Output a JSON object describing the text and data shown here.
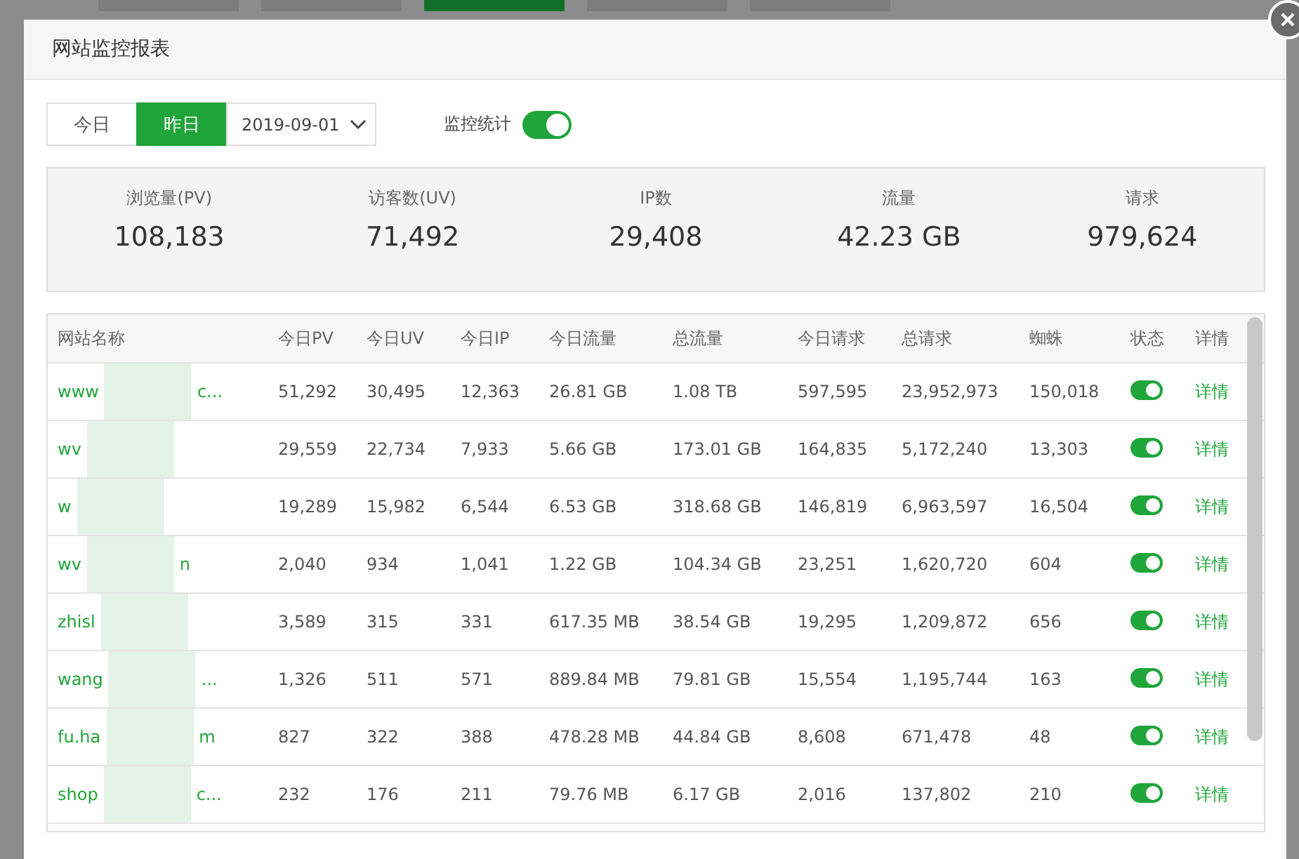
{
  "dialog": {
    "title": "网站监控报表"
  },
  "range_tabs": [
    {
      "label": "今日",
      "selected": false
    },
    {
      "label": "昨日",
      "selected": true
    }
  ],
  "date_select": {
    "value": "2019-09-01"
  },
  "monitor_switch": {
    "label": "监控统计",
    "on": true
  },
  "stats": [
    {
      "label": "浏览量(PV)",
      "value": "108,183"
    },
    {
      "label": "访客数(UV)",
      "value": "71,492"
    },
    {
      "label": "IP数",
      "value": "29,408"
    },
    {
      "label": "流量",
      "value": "42.23 GB"
    },
    {
      "label": "请求",
      "value": "979,624"
    }
  ],
  "table": {
    "columns": [
      "网站名称",
      "今日PV",
      "今日UV",
      "今日IP",
      "今日流量",
      "总流量",
      "今日请求",
      "总请求",
      "蜘蛛",
      "状态",
      "详情"
    ],
    "rows": [
      {
        "name_start": "www",
        "name_end": "c...",
        "pv": "51,292",
        "uv": "30,495",
        "ip": "12,363",
        "traffic": "26.81 GB",
        "total_traffic": "1.08 TB",
        "requests": "597,595",
        "total_requests": "23,952,973",
        "spiders": "150,018",
        "on": true,
        "detail": "详情"
      },
      {
        "name_start": "wv",
        "name_end": "",
        "pv": "29,559",
        "uv": "22,734",
        "ip": "7,933",
        "traffic": "5.66 GB",
        "total_traffic": "173.01 GB",
        "requests": "164,835",
        "total_requests": "5,172,240",
        "spiders": "13,303",
        "on": true,
        "detail": "详情"
      },
      {
        "name_start": "w",
        "name_end": "",
        "pv": "19,289",
        "uv": "15,982",
        "ip": "6,544",
        "traffic": "6.53 GB",
        "total_traffic": "318.68 GB",
        "requests": "146,819",
        "total_requests": "6,963,597",
        "spiders": "16,504",
        "on": true,
        "detail": "详情"
      },
      {
        "name_start": "wv",
        "name_end": "n",
        "pv": "2,040",
        "uv": "934",
        "ip": "1,041",
        "traffic": "1.22 GB",
        "total_traffic": "104.34 GB",
        "requests": "23,251",
        "total_requests": "1,620,720",
        "spiders": "604",
        "on": true,
        "detail": "详情"
      },
      {
        "name_start": "zhisl",
        "name_end": "",
        "pv": "3,589",
        "uv": "315",
        "ip": "331",
        "traffic": "617.35 MB",
        "total_traffic": "38.54 GB",
        "requests": "19,295",
        "total_requests": "1,209,872",
        "spiders": "656",
        "on": true,
        "detail": "详情"
      },
      {
        "name_start": "wang",
        "name_end": "...",
        "pv": "1,326",
        "uv": "511",
        "ip": "571",
        "traffic": "889.84 MB",
        "total_traffic": "79.81 GB",
        "requests": "15,554",
        "total_requests": "1,195,744",
        "spiders": "163",
        "on": true,
        "detail": "详情"
      },
      {
        "name_start": "fu.ha",
        "name_end": "m",
        "pv": "827",
        "uv": "322",
        "ip": "388",
        "traffic": "478.28 MB",
        "total_traffic": "44.84 GB",
        "requests": "8,608",
        "total_requests": "671,478",
        "spiders": "48",
        "on": true,
        "detail": "详情"
      },
      {
        "name_start": "shop",
        "name_end": "c...",
        "pv": "232",
        "uv": "176",
        "ip": "211",
        "traffic": "79.76 MB",
        "total_traffic": "6.17 GB",
        "requests": "2,016",
        "total_requests": "137,802",
        "spiders": "210",
        "on": true,
        "detail": "详情"
      }
    ]
  }
}
